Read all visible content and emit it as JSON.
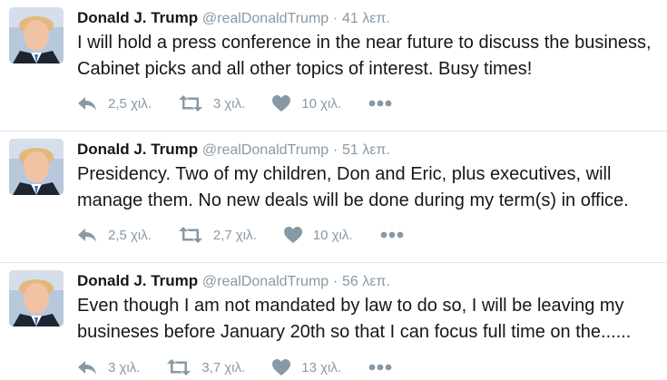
{
  "colors": {
    "text": "#14171a",
    "meta": "#8899a6",
    "divider": "#e1e8ed"
  },
  "tweets": [
    {
      "name": "Donald J. Trump",
      "handle": "@realDonaldTrump",
      "separator": "·",
      "time": "41 λεπ.",
      "text": "I will hold a press conference in the near future to discuss the business, Cabinet picks and all other topics of interest. Busy times!",
      "replies": "2,5 χιλ.",
      "retweets": "3 χιλ.",
      "likes": "10 χιλ."
    },
    {
      "name": "Donald J. Trump",
      "handle": "@realDonaldTrump",
      "separator": "·",
      "time": "51 λεπ.",
      "text": "Presidency. Two of my children, Don and Eric, plus executives, will manage them. No new deals will be done during my term(s) in office.",
      "replies": "2,5 χιλ.",
      "retweets": "2,7 χιλ.",
      "likes": "10 χιλ."
    },
    {
      "name": "Donald J. Trump",
      "handle": "@realDonaldTrump",
      "separator": "·",
      "time": "56 λεπ.",
      "text": "Even though I am not mandated by law to do so, I will be leaving my busineses before January 20th so that I can focus full time on the......",
      "replies": "3 χιλ.",
      "retweets": "3,7 χιλ.",
      "likes": "13 χιλ."
    }
  ]
}
